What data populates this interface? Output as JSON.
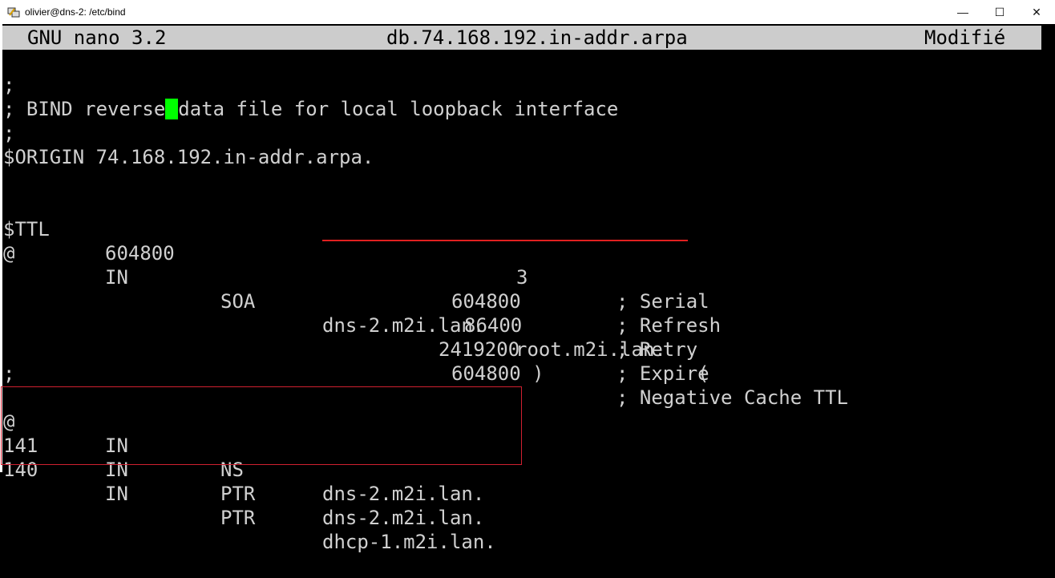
{
  "window": {
    "title": "olivier@dns-2: /etc/bind",
    "icon": "putty-icon",
    "controls": {
      "minimize": "—",
      "maximize": "☐",
      "close": "✕"
    }
  },
  "nano": {
    "version": "GNU nano 3.2",
    "filename": "db.74.168.192.in-addr.arpa",
    "status": "Modifié"
  },
  "file": {
    "l1": ";",
    "l2_before_cursor": "; BIND reverse",
    "l2_after_cursor": "data file for local loopback interface",
    "l3": ";",
    "origin": "$ORIGIN 74.168.192.in-addr.arpa.",
    "ttl_key": "$TTL",
    "ttl_val": "604800",
    "soa": {
      "name": "@",
      "class": "IN",
      "type": "SOA",
      "mname": "dns-2.m2i.lan.",
      "rname": "root.m2i.lan.",
      "paren": "("
    },
    "serial": {
      "value": "3",
      "comment": "; Serial"
    },
    "refresh": {
      "value": "604800",
      "comment": "; Refresh"
    },
    "retry": {
      "value": "86400",
      "comment": "; Retry"
    },
    "expire": {
      "value": "2419200",
      "comment": "; Expire"
    },
    "negttl": {
      "value": "604800 )",
      "comment": "; Negative Cache TTL"
    },
    "l_sep": ";",
    "records": [
      {
        "name": "@",
        "class": "IN",
        "type": "NS",
        "data": "dns-2.m2i.lan."
      },
      {
        "name": "141",
        "class": "IN",
        "type": "PTR",
        "data": "dns-2.m2i.lan."
      },
      {
        "name": "140",
        "class": "IN",
        "type": "PTR",
        "data": "dhcp-1.m2i.lan."
      }
    ]
  },
  "colors": {
    "text": "#d0d0d0",
    "cursor": "#00ff00",
    "highlight": "#d02030",
    "header_bg": "#cccccc"
  }
}
